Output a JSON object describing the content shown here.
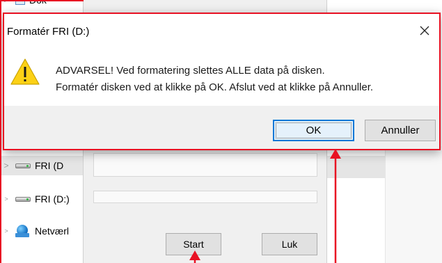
{
  "explorer": {
    "top_item_label": "Dok",
    "tree_items": [
      {
        "label": "FRI (D",
        "icon": "drive-icon"
      },
      {
        "label": "FRI (D:)",
        "icon": "drive-icon"
      },
      {
        "label": "Netværl",
        "icon": "network-icon"
      }
    ]
  },
  "format_window": {
    "start_label": "Start",
    "close_label": "Luk"
  },
  "dialog": {
    "title": "Formatér FRI (D:)",
    "close_icon": "close-icon",
    "warning_icon": "warning-icon",
    "message_line1": "ADVARSEL! Ved formatering slettes ALLE data på disken.",
    "message_line2": "Formatér disken ved at klikke på OK. Afslut ved at klikke på Annuller.",
    "ok_label": "OK",
    "cancel_label": "Annuller"
  },
  "colors": {
    "annotation_red": "#e81123",
    "ok_focus_blue": "#0078d7",
    "warning_yellow": "#fcd116"
  }
}
